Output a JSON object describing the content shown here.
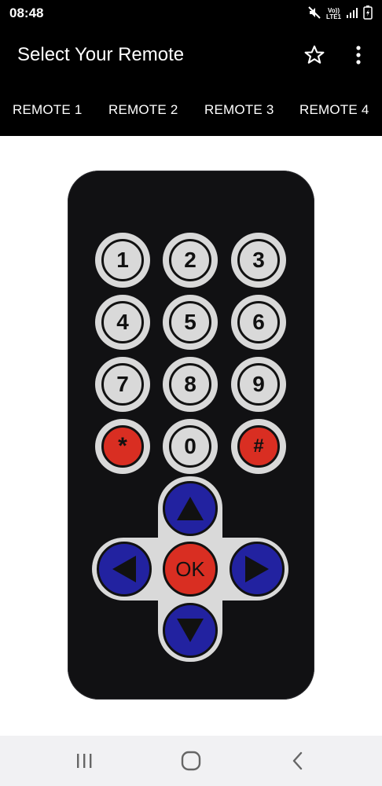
{
  "status_bar": {
    "time": "08:48",
    "volte_label": "Vo))",
    "lte_label": "LTE1",
    "icons": [
      "mute-icon",
      "signal-icon",
      "battery-icon"
    ]
  },
  "app_bar": {
    "title": "Select Your Remote",
    "favorite_icon": "star-outline-icon",
    "more_icon": "more-vert-icon"
  },
  "tabs": [
    {
      "label": "REMOTE 1"
    },
    {
      "label": "REMOTE 2"
    },
    {
      "label": "REMOTE 3"
    },
    {
      "label": "REMOTE 4"
    }
  ],
  "remote": {
    "keys": {
      "k1": "1",
      "k2": "2",
      "k3": "3",
      "k4": "4",
      "k5": "5",
      "k6": "6",
      "k7": "7",
      "k8": "8",
      "k9": "9",
      "star": "*",
      "k0": "0",
      "hash": "#"
    },
    "ok": "OK",
    "colors": {
      "body": "#111113",
      "key_face": "#d9d9d9",
      "red_key": "#d92e22",
      "blue_key": "#2222a0"
    }
  },
  "nav_bar": {
    "icons": [
      "recent-apps-icon",
      "home-icon",
      "back-icon"
    ]
  }
}
